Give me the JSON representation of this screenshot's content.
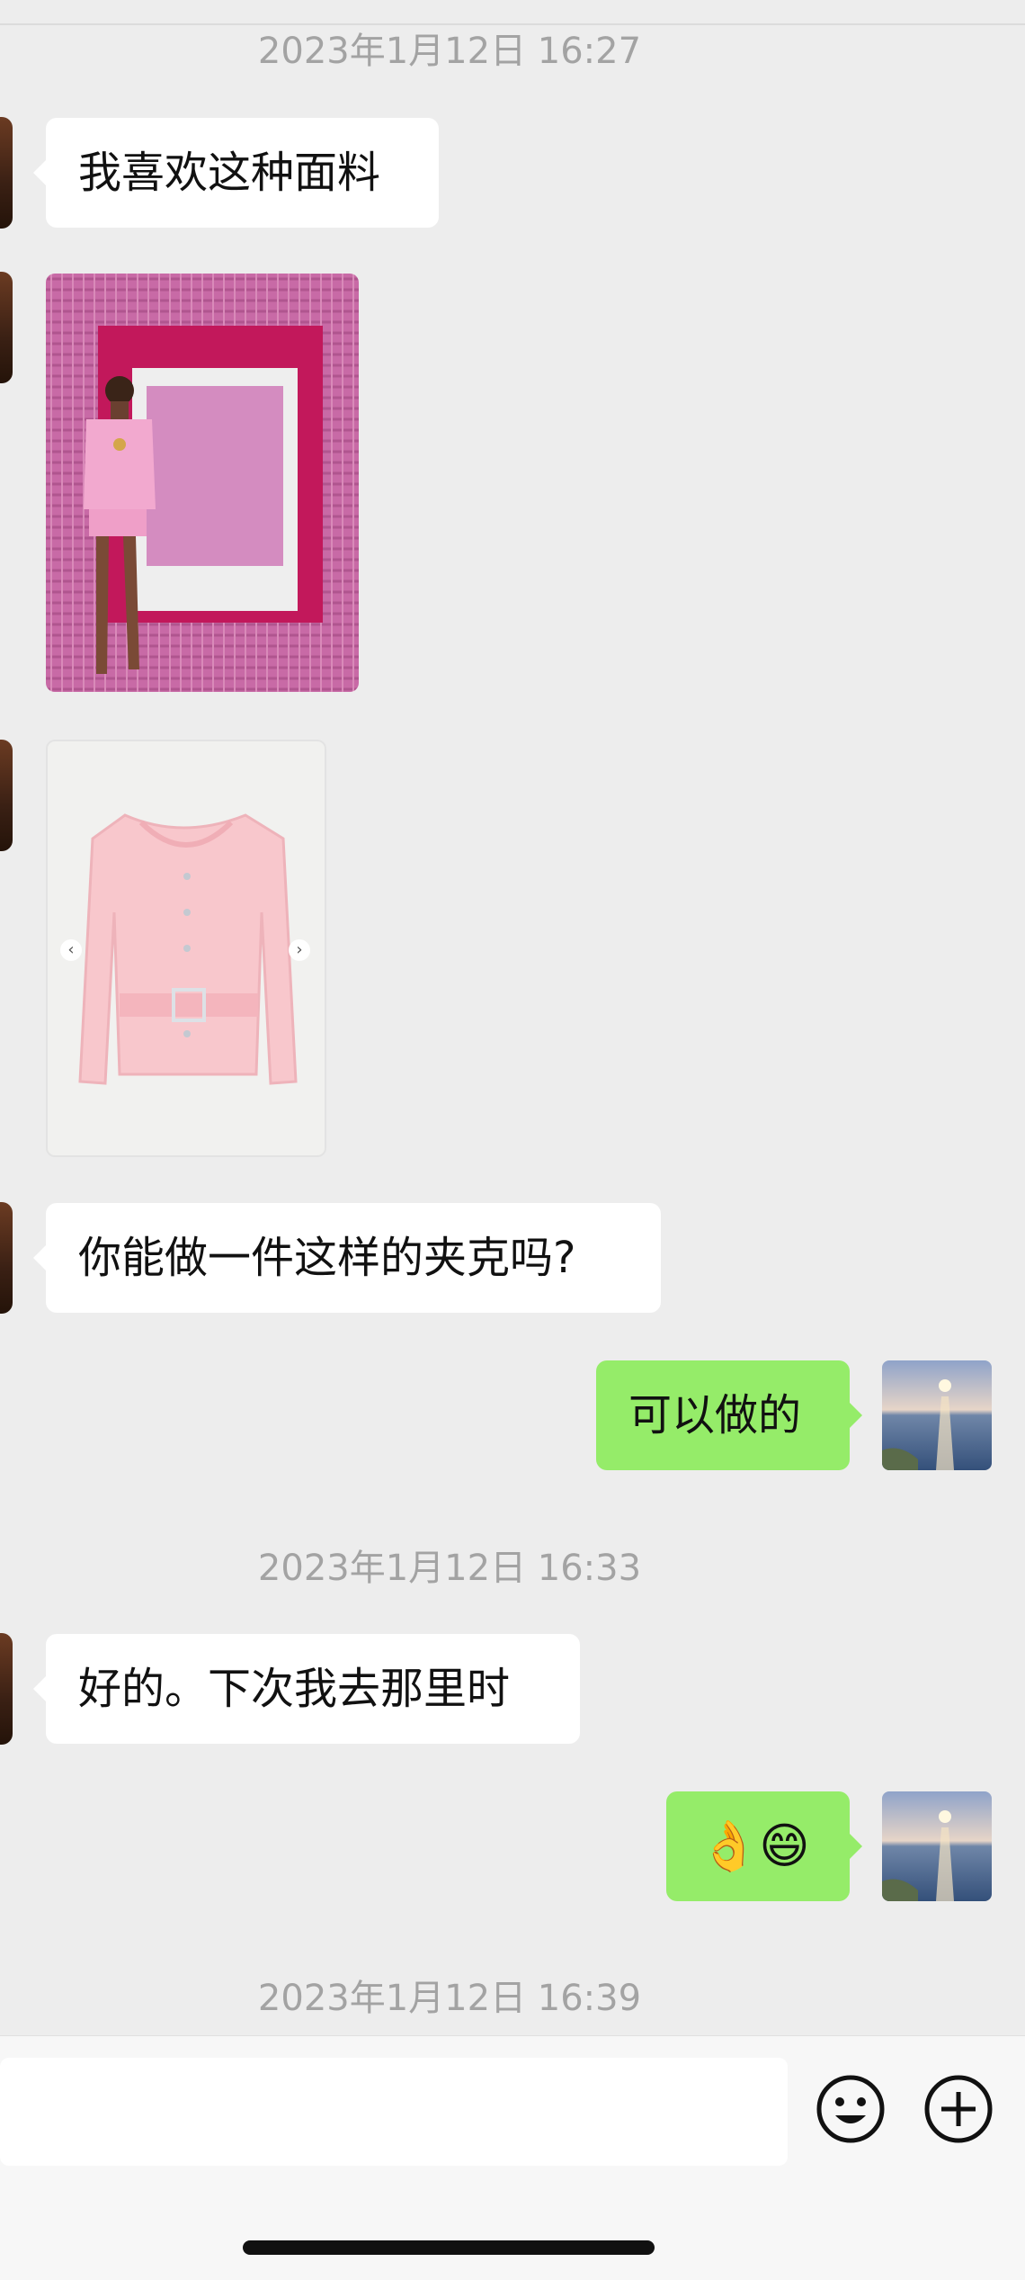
{
  "timestamps": [
    "2023年1月12日 16:27",
    "2023年1月12日 16:33",
    "2023年1月12日 16:39"
  ],
  "messages": {
    "m1": "我喜欢这种面料",
    "m4": "你能做一件这样的夹克吗?",
    "m5": "可以做的",
    "m6": "好的。下次我去那里时",
    "m7": "👌😄"
  },
  "images": {
    "photo1": "runway-model-pink-tweed-suit",
    "photo2": "pink-tweed-belted-jacket",
    "photo2_prev": "‹",
    "photo2_next": "›"
  },
  "input": {
    "value": "",
    "placeholder": ""
  },
  "icons": {
    "emoji": "emoji-icon",
    "plus": "plus-icon"
  },
  "colors": {
    "background": "#ededed",
    "incoming_bubble": "#ffffff",
    "outgoing_bubble": "#95ec69",
    "timestamp": "#a3a3a3"
  }
}
